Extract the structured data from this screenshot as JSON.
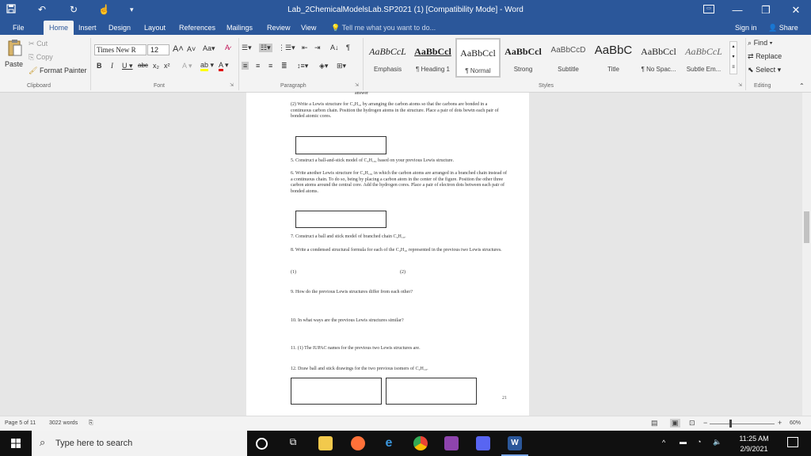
{
  "titlebar": {
    "title": "Lab_2ChemicalModelsLab.SP2021 (1) [Compatibility Mode] - Word",
    "minimize": "—",
    "restore": "❐",
    "close": "✕"
  },
  "tabs": [
    "File",
    "Home",
    "Insert",
    "Design",
    "Layout",
    "References",
    "Mailings",
    "Review",
    "View"
  ],
  "active_tab": "Home",
  "tellme": "Tell me what you want to do...",
  "signin": "Sign in",
  "share": "Share",
  "clipboard": {
    "paste": "Paste",
    "cut": "Cut",
    "copy": "Copy",
    "format_painter": "Format Painter",
    "label": "Clipboard"
  },
  "font": {
    "name": "Times New R",
    "size": "12",
    "label": "Font"
  },
  "paragraph_label": "Paragraph",
  "styles": {
    "label": "Styles",
    "items": [
      {
        "preview": "AaBbCcL",
        "name": "Emphasis"
      },
      {
        "preview": "AaBbCcl",
        "name": "¶ Heading 1"
      },
      {
        "preview": "AaBbCcl",
        "name": "¶ Normal"
      },
      {
        "preview": "AaBbCcl",
        "name": "Strong"
      },
      {
        "preview": "AaBbCcD",
        "name": "Subtitle"
      },
      {
        "preview": "AaBbC",
        "name": "Title"
      },
      {
        "preview": "AaBbCcl",
        "name": "¶ No Spac..."
      },
      {
        "preview": "AaBbCcL",
        "name": "Subtle Em..."
      }
    ]
  },
  "editing": {
    "find": "Find",
    "replace": "Replace",
    "select": "Select",
    "label": "Editing"
  },
  "document": {
    "answer": "answer",
    "q2": "(2) Write a Lewis structure for C₄H₁₀ by arranging the carbon atoms so that the carbons are bonded in a continuous carbon chain. Position the hydrogen atoms in the structure. Place a pair of dots bewtn each pair of bonded atomic cores.",
    "q5": "5. Construct a ball-and-stick model of C₄H₁₀, based on your previous Lewis structure.",
    "q6": "6. Write another Lewis structure for C₄H₁₀, in which the carbon atoms are arranged in a branched chain instead of a continuous chain. To do so, being by placing a carbon atom in the center of the figure. Position the other three carbon atoms around the central core. Add the hydrogen cores. Place a pair of electron dots between each pair of bonded atoms.",
    "q7": "7. Construct a ball and stick model of branched chain C₄H₁₀.",
    "q8": "8. Write a condensed structural formula for each of the C₄H₁₀ represented in the previous two Lewis structures.",
    "q8_1": "(1)",
    "q8_2": "(2)",
    "q9": "9. How do the previous Lewis structures differ from each other?",
    "q10": "10. In what ways are the previous Lewis structures similar?",
    "q11": "11. (1) The IUPAC names for the previous two Lewis structures are.",
    "q12": "12. Draw ball and stick drawings for the two previous isomers of C₄H₁₀.",
    "page_number": "21"
  },
  "statusbar": {
    "page": "Page 5 of 11",
    "words": "3022 words",
    "zoom": "60%"
  },
  "taskbar": {
    "search_placeholder": "Type here to search",
    "time": "11:25 AM",
    "date": "2/9/2021"
  }
}
